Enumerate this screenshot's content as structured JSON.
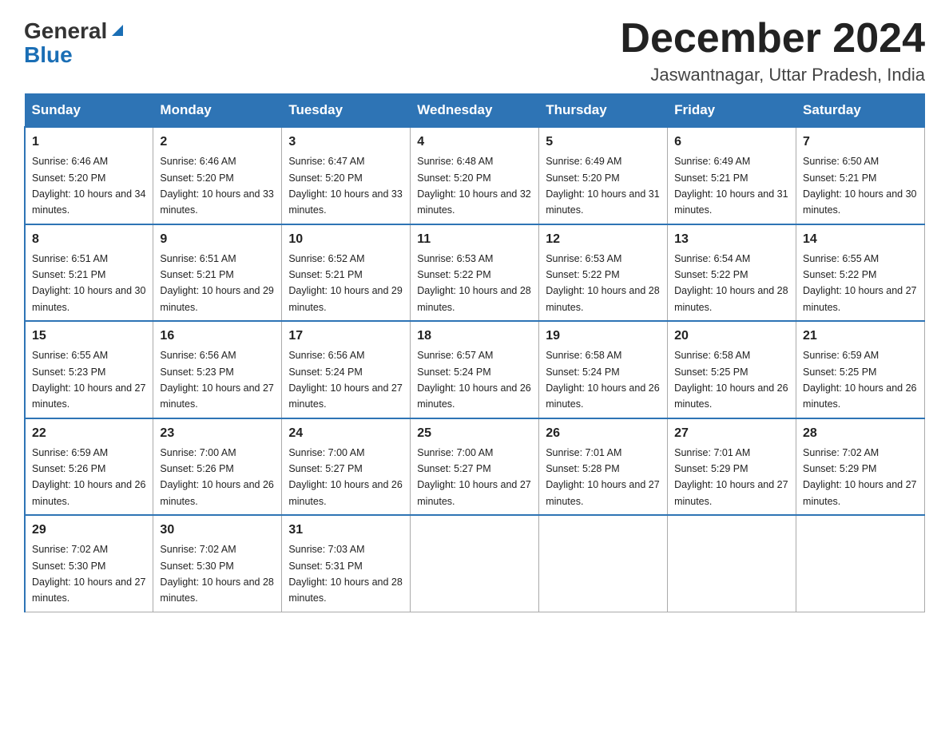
{
  "logo": {
    "text_general": "General",
    "text_blue": "Blue"
  },
  "header": {
    "month": "December 2024",
    "location": "Jaswantnagar, Uttar Pradesh, India"
  },
  "weekdays": [
    "Sunday",
    "Monday",
    "Tuesday",
    "Wednesday",
    "Thursday",
    "Friday",
    "Saturday"
  ],
  "weeks": [
    [
      {
        "day": "1",
        "sunrise": "6:46 AM",
        "sunset": "5:20 PM",
        "daylight": "10 hours and 34 minutes."
      },
      {
        "day": "2",
        "sunrise": "6:46 AM",
        "sunset": "5:20 PM",
        "daylight": "10 hours and 33 minutes."
      },
      {
        "day": "3",
        "sunrise": "6:47 AM",
        "sunset": "5:20 PM",
        "daylight": "10 hours and 33 minutes."
      },
      {
        "day": "4",
        "sunrise": "6:48 AM",
        "sunset": "5:20 PM",
        "daylight": "10 hours and 32 minutes."
      },
      {
        "day": "5",
        "sunrise": "6:49 AM",
        "sunset": "5:20 PM",
        "daylight": "10 hours and 31 minutes."
      },
      {
        "day": "6",
        "sunrise": "6:49 AM",
        "sunset": "5:21 PM",
        "daylight": "10 hours and 31 minutes."
      },
      {
        "day": "7",
        "sunrise": "6:50 AM",
        "sunset": "5:21 PM",
        "daylight": "10 hours and 30 minutes."
      }
    ],
    [
      {
        "day": "8",
        "sunrise": "6:51 AM",
        "sunset": "5:21 PM",
        "daylight": "10 hours and 30 minutes."
      },
      {
        "day": "9",
        "sunrise": "6:51 AM",
        "sunset": "5:21 PM",
        "daylight": "10 hours and 29 minutes."
      },
      {
        "day": "10",
        "sunrise": "6:52 AM",
        "sunset": "5:21 PM",
        "daylight": "10 hours and 29 minutes."
      },
      {
        "day": "11",
        "sunrise": "6:53 AM",
        "sunset": "5:22 PM",
        "daylight": "10 hours and 28 minutes."
      },
      {
        "day": "12",
        "sunrise": "6:53 AM",
        "sunset": "5:22 PM",
        "daylight": "10 hours and 28 minutes."
      },
      {
        "day": "13",
        "sunrise": "6:54 AM",
        "sunset": "5:22 PM",
        "daylight": "10 hours and 28 minutes."
      },
      {
        "day": "14",
        "sunrise": "6:55 AM",
        "sunset": "5:22 PM",
        "daylight": "10 hours and 27 minutes."
      }
    ],
    [
      {
        "day": "15",
        "sunrise": "6:55 AM",
        "sunset": "5:23 PM",
        "daylight": "10 hours and 27 minutes."
      },
      {
        "day": "16",
        "sunrise": "6:56 AM",
        "sunset": "5:23 PM",
        "daylight": "10 hours and 27 minutes."
      },
      {
        "day": "17",
        "sunrise": "6:56 AM",
        "sunset": "5:24 PM",
        "daylight": "10 hours and 27 minutes."
      },
      {
        "day": "18",
        "sunrise": "6:57 AM",
        "sunset": "5:24 PM",
        "daylight": "10 hours and 26 minutes."
      },
      {
        "day": "19",
        "sunrise": "6:58 AM",
        "sunset": "5:24 PM",
        "daylight": "10 hours and 26 minutes."
      },
      {
        "day": "20",
        "sunrise": "6:58 AM",
        "sunset": "5:25 PM",
        "daylight": "10 hours and 26 minutes."
      },
      {
        "day": "21",
        "sunrise": "6:59 AM",
        "sunset": "5:25 PM",
        "daylight": "10 hours and 26 minutes."
      }
    ],
    [
      {
        "day": "22",
        "sunrise": "6:59 AM",
        "sunset": "5:26 PM",
        "daylight": "10 hours and 26 minutes."
      },
      {
        "day": "23",
        "sunrise": "7:00 AM",
        "sunset": "5:26 PM",
        "daylight": "10 hours and 26 minutes."
      },
      {
        "day": "24",
        "sunrise": "7:00 AM",
        "sunset": "5:27 PM",
        "daylight": "10 hours and 26 minutes."
      },
      {
        "day": "25",
        "sunrise": "7:00 AM",
        "sunset": "5:27 PM",
        "daylight": "10 hours and 27 minutes."
      },
      {
        "day": "26",
        "sunrise": "7:01 AM",
        "sunset": "5:28 PM",
        "daylight": "10 hours and 27 minutes."
      },
      {
        "day": "27",
        "sunrise": "7:01 AM",
        "sunset": "5:29 PM",
        "daylight": "10 hours and 27 minutes."
      },
      {
        "day": "28",
        "sunrise": "7:02 AM",
        "sunset": "5:29 PM",
        "daylight": "10 hours and 27 minutes."
      }
    ],
    [
      {
        "day": "29",
        "sunrise": "7:02 AM",
        "sunset": "5:30 PM",
        "daylight": "10 hours and 27 minutes."
      },
      {
        "day": "30",
        "sunrise": "7:02 AM",
        "sunset": "5:30 PM",
        "daylight": "10 hours and 28 minutes."
      },
      {
        "day": "31",
        "sunrise": "7:03 AM",
        "sunset": "5:31 PM",
        "daylight": "10 hours and 28 minutes."
      },
      null,
      null,
      null,
      null
    ]
  ]
}
